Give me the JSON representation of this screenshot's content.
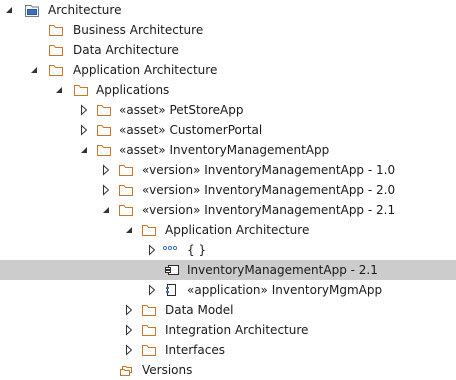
{
  "colors": {
    "folder_stroke": "#c9782b",
    "selected_bg": "#cccccc",
    "expander": "#333333",
    "package_blue": "#3a6fc4"
  },
  "tree": [
    {
      "id": "architecture",
      "label": "Architecture",
      "icon": "package-icon",
      "expander": "expanded"
    },
    {
      "id": "business-architecture",
      "label": "Business Architecture",
      "icon": "folder-icon",
      "expander": "none"
    },
    {
      "id": "data-architecture",
      "label": "Data Architecture",
      "icon": "folder-icon",
      "expander": "none"
    },
    {
      "id": "application-architecture",
      "label": "Application Architecture",
      "icon": "folder-icon",
      "expander": "expanded"
    },
    {
      "id": "applications",
      "label": "Applications",
      "icon": "folder-icon",
      "expander": "expanded"
    },
    {
      "id": "petstoreapp",
      "label": "«asset» PetStoreApp",
      "icon": "folder-icon",
      "expander": "collapsed"
    },
    {
      "id": "customerportal",
      "label": "«asset» CustomerPortal",
      "icon": "folder-icon",
      "expander": "collapsed"
    },
    {
      "id": "inventorymanagementapp",
      "label": "«asset» InventoryManagementApp",
      "icon": "folder-icon",
      "expander": "expanded"
    },
    {
      "id": "version-1-0",
      "label": "«version» InventoryManagementApp - 1.0",
      "icon": "folder-icon",
      "expander": "collapsed"
    },
    {
      "id": "version-2-0",
      "label": "«version» InventoryManagementApp - 2.0",
      "icon": "folder-icon",
      "expander": "collapsed"
    },
    {
      "id": "version-2-1",
      "label": "«version» InventoryManagementApp - 2.1",
      "icon": "folder-icon",
      "expander": "expanded"
    },
    {
      "id": "app-architecture-inner",
      "label": "Application Architecture",
      "icon": "folder-icon",
      "expander": "expanded"
    },
    {
      "id": "braces",
      "label": "{ }",
      "icon": "dots-icon",
      "expander": "collapsed"
    },
    {
      "id": "imapp-2-1",
      "label": "InventoryManagementApp - 2.1",
      "icon": "component-icon",
      "expander": "none",
      "selected": true
    },
    {
      "id": "inventorymgmapp",
      "label": "«application» InventoryMgmApp",
      "icon": "application-icon",
      "expander": "collapsed"
    },
    {
      "id": "data-model",
      "label": "Data Model",
      "icon": "folder-icon",
      "expander": "collapsed"
    },
    {
      "id": "integration-architecture",
      "label": "Integration Architecture",
      "icon": "folder-icon",
      "expander": "collapsed"
    },
    {
      "id": "interfaces",
      "label": "Interfaces",
      "icon": "folder-icon",
      "expander": "collapsed"
    },
    {
      "id": "versions",
      "label": "Versions",
      "icon": "versions-icon",
      "expander": "none"
    }
  ]
}
